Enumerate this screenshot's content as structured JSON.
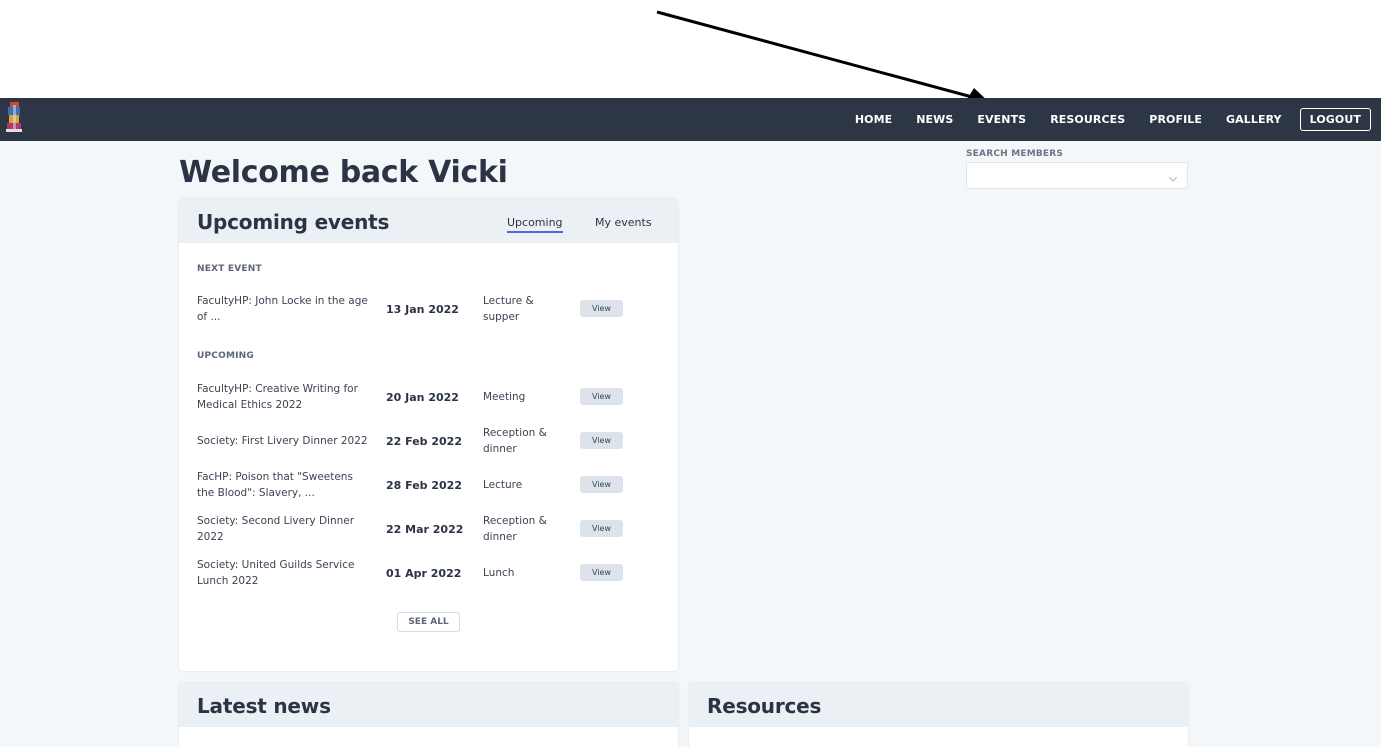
{
  "nav": {
    "items": [
      {
        "id": "home",
        "label": "HOME"
      },
      {
        "id": "news",
        "label": "NEWS"
      },
      {
        "id": "events",
        "label": "EVENTS"
      },
      {
        "id": "resources",
        "label": "RESOURCES"
      },
      {
        "id": "profile",
        "label": "PROFILE"
      },
      {
        "id": "gallery",
        "label": "GALLERY"
      }
    ],
    "logout_label": "LOGOUT",
    "logo_icon": "crest-icon"
  },
  "welcome": "Welcome back Vicki",
  "search": {
    "label": "SEARCH MEMBERS",
    "value": "",
    "icon": "chevron-down-icon"
  },
  "events": {
    "title": "Upcoming events",
    "tabs": {
      "upcoming": "Upcoming",
      "my_events": "My events"
    },
    "next_label": "NEXT EVENT",
    "upcoming_label": "UPCOMING",
    "view_label": "View",
    "next": [
      {
        "title": "FacultyHP: John Locke in the age of ...",
        "date": "13 Jan 2022",
        "type": "Lecture & supper"
      }
    ],
    "upcoming": [
      {
        "title": "FacultyHP: Creative Writing for Medical Ethics 2022",
        "date": "20 Jan 2022",
        "type": "Meeting"
      },
      {
        "title": "Society: First Livery Dinner 2022",
        "date": "22 Feb 2022",
        "type": "Reception & dinner"
      },
      {
        "title": "FacHP: Poison that \"Sweetens the Blood\": Slavery, ...",
        "date": "28 Feb 2022",
        "type": "Lecture"
      },
      {
        "title": "Society: Second Livery Dinner 2022",
        "date": "22 Mar 2022",
        "type": "Reception & dinner"
      },
      {
        "title": "Society: United Guilds Service Lunch 2022",
        "date": "01 Apr 2022",
        "type": "Lunch"
      }
    ],
    "see_all_label": "SEE ALL"
  },
  "news": {
    "title": "Latest news"
  },
  "resources": {
    "title": "Resources"
  },
  "colors": {
    "navbar": "#2d3644",
    "page_bg": "#f4f7fa",
    "card_header": "#ebf0f4",
    "tab_underline": "#5367d8"
  }
}
